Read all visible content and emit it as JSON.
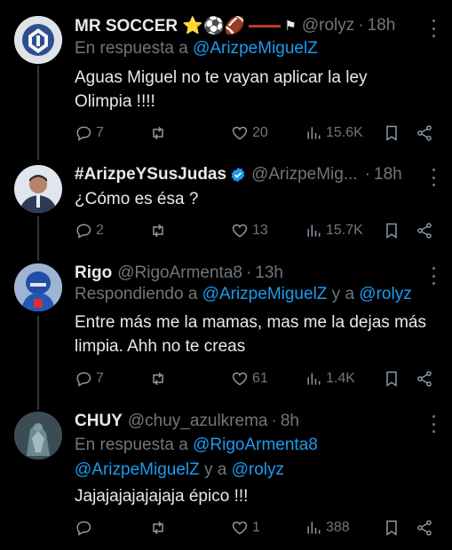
{
  "tweets": [
    {
      "name": "MR SOCCER ⭐⚽🏈",
      "handle": "@rolyz",
      "dot": "·",
      "time": "18h",
      "reply_prefix": "En respuesta a ",
      "mentions": [
        "@ArizpeMiguelZ"
      ],
      "text": "Aguas Miguel no te vayan aplicar la ley Olimpia !!!!",
      "replies": "7",
      "retweets": "",
      "likes": "20",
      "views": "15.6K"
    },
    {
      "name": "#ArizpeYSusJudas",
      "verified": true,
      "handle": "@ArizpeMig...",
      "dot": "·",
      "time": "18h",
      "text": "¿Cómo es ésa ?",
      "replies": "2",
      "retweets": "",
      "likes": "13",
      "views": "15.7K"
    },
    {
      "name": "Rigo",
      "handle": "@RigoArmenta8",
      "dot": "·",
      "time": "13h",
      "reply_prefix": "Respondiendo a ",
      "mentions": [
        "@ArizpeMiguelZ",
        "@rolyz"
      ],
      "reply_joiner": " y a ",
      "text": "Entre más me la mamas, mas me la dejas más limpia. Ahh no te creas",
      "replies": "7",
      "retweets": "",
      "likes": "61",
      "views": "1.4K"
    },
    {
      "name": "CHUY",
      "handle": "@chuy_azulkrema",
      "dot": "·",
      "time": "8h",
      "reply_prefix": "En respuesta a ",
      "mentions": [
        "@RigoArmenta8",
        "@ArizpeMiguelZ",
        "@rolyz"
      ],
      "reply_joiner": " y a ",
      "text": "Jajajajajajajaja épico !!!",
      "replies": "",
      "retweets": "",
      "likes": "1",
      "views": "388"
    }
  ],
  "colors": {
    "background": "#000000",
    "text": "#e7e9ea",
    "muted": "#71767b",
    "link": "#1d9bf0",
    "verified": "#1d9bf0"
  },
  "icons": [
    "reply-icon",
    "retweet-icon",
    "like-icon",
    "views-icon",
    "bookmark-icon",
    "share-icon",
    "more-icon",
    "verified-badge-icon"
  ]
}
